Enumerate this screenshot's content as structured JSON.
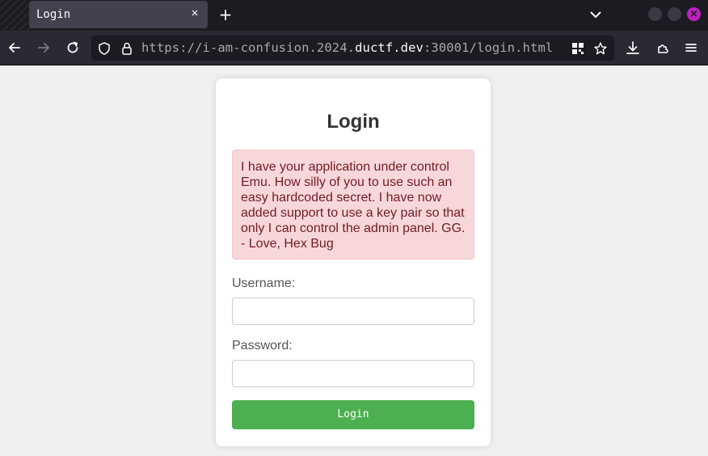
{
  "browser": {
    "tab": {
      "title": "Login",
      "close_glyph": "✕"
    },
    "new_tab_glyph": "+",
    "url": {
      "prefix": "https://i-am-confusion.2024.",
      "domain": "ductf.dev",
      "suffix": ":30001/login.html"
    },
    "icons": [
      "back-arrow-icon",
      "forward-arrow-icon",
      "reload-icon",
      "shield-icon",
      "lock-icon",
      "qr-code-icon",
      "bookmark-star-icon",
      "download-icon",
      "extensions-icon",
      "menu-icon"
    ]
  },
  "page": {
    "title": "Login",
    "alert": "I have your application under control Emu. How silly of you to use such an easy hardcoded secret. I have now added support to use a key pair so that only I can control the admin panel. GG. - Love, Hex Bug",
    "username_label": "Username:",
    "username_value": "",
    "password_label": "Password:",
    "password_value": "",
    "button_label": "Login",
    "colors": {
      "button": "#4caf50",
      "alert_bg": "#f8d7da",
      "alert_text": "#721c24"
    }
  }
}
